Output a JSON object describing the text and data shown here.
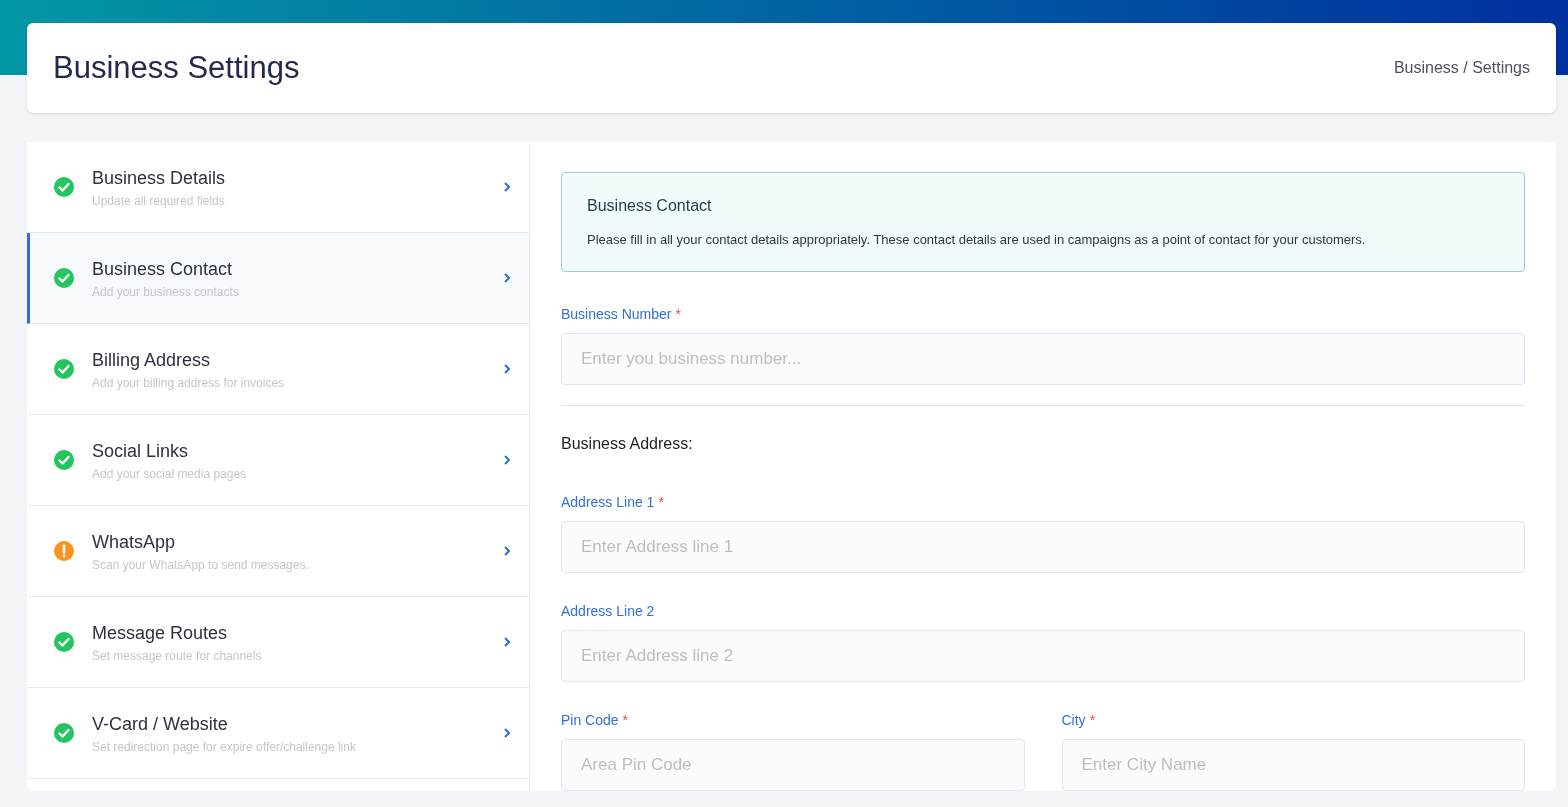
{
  "header": {
    "title": "Business Settings",
    "breadcrumb": "Business / Settings"
  },
  "sidebar": {
    "items": [
      {
        "title": "Business Details",
        "subtitle": "Update all required fields",
        "kind": "complete",
        "selected": false
      },
      {
        "title": "Business Contact",
        "subtitle": "Add your business contacts",
        "kind": "complete",
        "selected": true
      },
      {
        "title": "Billing Address",
        "subtitle": "Add your billing address for invoices",
        "kind": "complete",
        "selected": false
      },
      {
        "title": "Social Links",
        "subtitle": "Add your social media pages",
        "kind": "complete",
        "selected": false
      },
      {
        "title": "WhatsApp",
        "subtitle": "Scan your WhatsApp to send messages.",
        "kind": "warning",
        "selected": false
      },
      {
        "title": "Message Routes",
        "subtitle": "Set message route for channels",
        "kind": "complete",
        "selected": false
      },
      {
        "title": "V-Card / Website",
        "subtitle": "Set redirection page for expire offer/challenge link",
        "kind": "complete",
        "selected": false
      }
    ]
  },
  "info": {
    "title": "Business Contact",
    "text": "Please fill in all your contact details appropriately. These contact details are used in campaigns as a point of contact for your customers."
  },
  "business_number": {
    "label": "Business Number",
    "required_mark": "*",
    "placeholder": "Enter you business number..."
  },
  "address_heading": "Business Address:",
  "address_fields": [
    {
      "label": "Address Line 1",
      "required_mark": "*",
      "placeholder": "Enter Address line 1"
    },
    {
      "label": "Address Line 2",
      "placeholder": "Enter Address line 2"
    }
  ],
  "location_fields": [
    {
      "label": "Pin Code",
      "required_mark": "*",
      "placeholder": "Area Pin Code"
    },
    {
      "label": "City",
      "required_mark": "*",
      "placeholder": "Enter City Name"
    }
  ]
}
